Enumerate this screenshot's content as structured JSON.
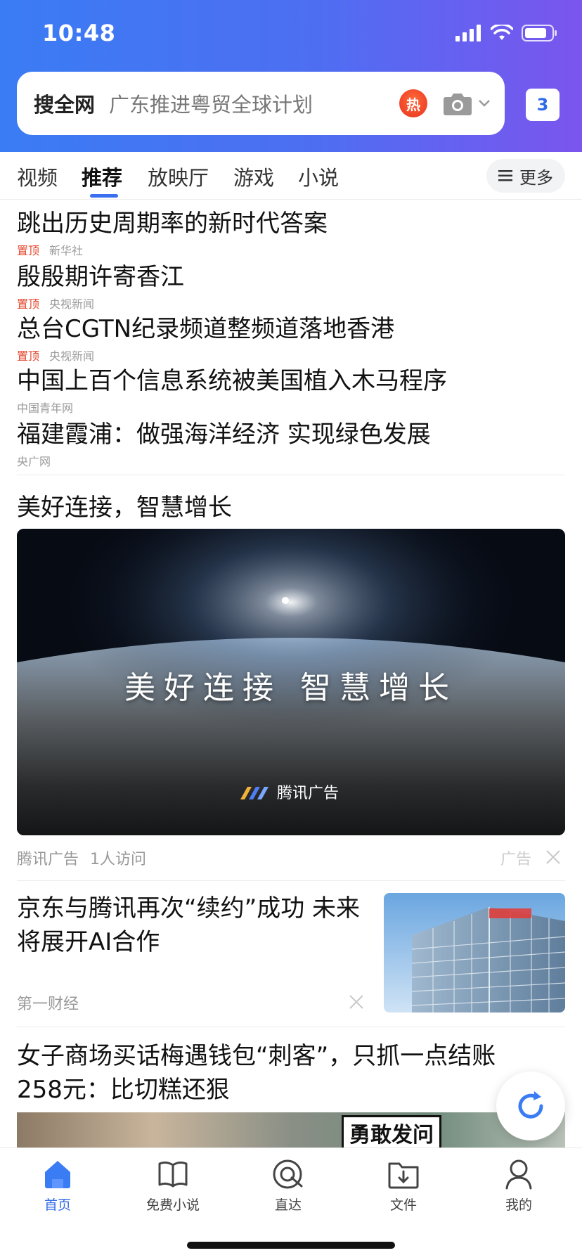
{
  "status_bar": {
    "time": "10:48"
  },
  "search": {
    "prefix": "搜全网",
    "hint": "广东推进粤贸全球计划",
    "hot_badge": "热",
    "tab_count": "3"
  },
  "channels": {
    "tabs": [
      "视频",
      "推荐",
      "放映厅",
      "游戏",
      "小说"
    ],
    "active": "推荐",
    "more_label": "更多"
  },
  "headlines": [
    {
      "title": "跳出历史周期率的新时代答案",
      "pinned": "置顶",
      "source": "新华社"
    },
    {
      "title": "殷殷期许寄香江",
      "pinned": "置顶",
      "source": "央视新闻"
    },
    {
      "title": "总台CGTN纪录频道整频道落地香港",
      "pinned": "置顶",
      "source": "央视新闻"
    },
    {
      "title": "中国上百个信息系统被美国植入木马程序",
      "pinned": "",
      "source": "中国青年网"
    },
    {
      "title": "福建霞浦：做强海洋经济 实现绿色发展",
      "pinned": "",
      "source": "央广网"
    }
  ],
  "ad": {
    "title": "美好连接，智慧增长",
    "image_text": "美好连接 智慧增长",
    "image_logo": "腾讯广告",
    "advertiser": "腾讯广告",
    "visits": "1人访问",
    "label": "广告"
  },
  "articles": [
    {
      "title": "京东与腾讯再次“续约”成功 未来将展开AI合作",
      "source": "第一财经",
      "thumb_icon": "jd-building-image"
    },
    {
      "title": "女子商场买话梅遇钱包“刺客”，只抓一点结账258元：比切糕还狠",
      "image_caption": "勇敢发问"
    }
  ],
  "bottom_nav": [
    {
      "label": "首页",
      "icon": "home-icon",
      "active": true
    },
    {
      "label": "免费小说",
      "icon": "book-icon",
      "active": false
    },
    {
      "label": "直达",
      "icon": "direct-icon",
      "active": false
    },
    {
      "label": "文件",
      "icon": "file-icon",
      "active": false
    },
    {
      "label": "我的",
      "icon": "profile-icon",
      "active": false
    }
  ],
  "colors": {
    "accent": "#2f6ae8",
    "pin": "#e4462c",
    "header_start": "#3a7cf4",
    "header_end": "#7b55ee"
  }
}
